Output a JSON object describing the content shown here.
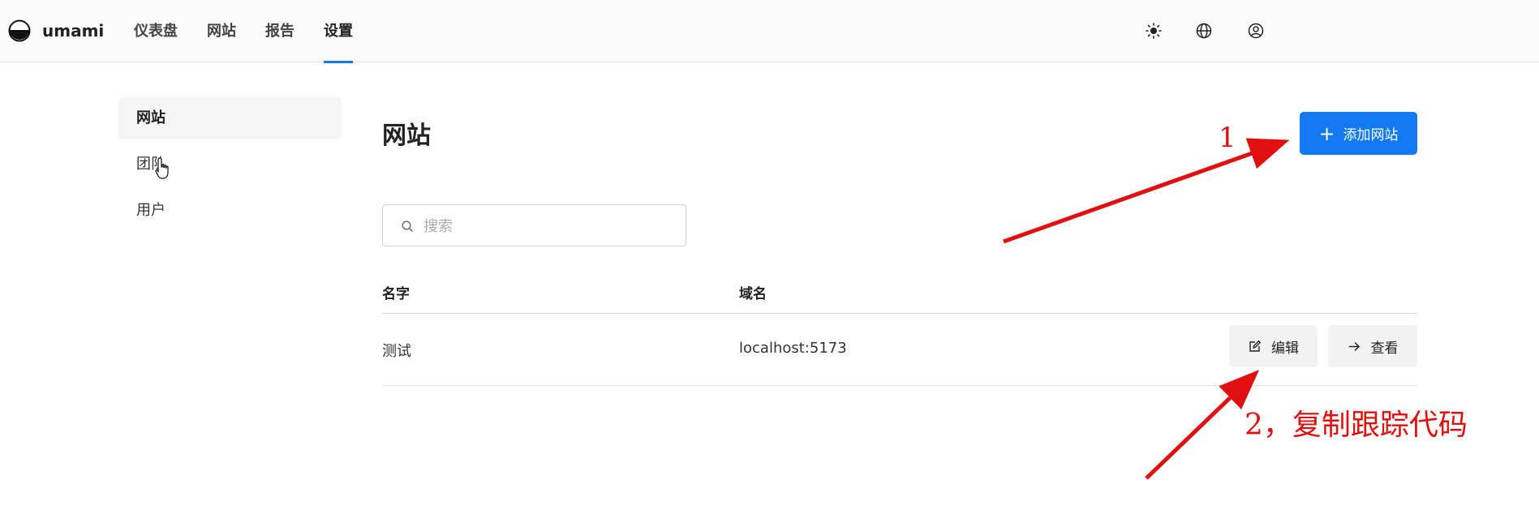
{
  "app": {
    "brand": "umami",
    "nav": [
      {
        "label": "仪表盘"
      },
      {
        "label": "网站"
      },
      {
        "label": "报告"
      },
      {
        "label": "设置"
      }
    ],
    "active_nav": "设置",
    "header_icons": [
      "theme-sun-icon",
      "language-globe-icon",
      "user-profile-icon"
    ]
  },
  "sidebar": {
    "items": [
      {
        "label": "网站",
        "active": true
      },
      {
        "label": "团队",
        "active": false
      },
      {
        "label": "用户",
        "active": false
      }
    ]
  },
  "main": {
    "title": "网站",
    "add_button_label": "添加网站",
    "search_placeholder": "搜索",
    "table": {
      "columns": [
        "名字",
        "域名"
      ],
      "rows": [
        {
          "name": "测试",
          "domain": "localhost:5173",
          "edit_label": "编辑",
          "view_label": "查看"
        }
      ]
    }
  },
  "annotations": {
    "step1": "1",
    "step2": "2，复制跟踪代码",
    "color": "#e01010"
  },
  "colors": {
    "accent": "#147af3",
    "topbar_bg": "#fafafa",
    "button_bg": "#f2f2f2"
  }
}
